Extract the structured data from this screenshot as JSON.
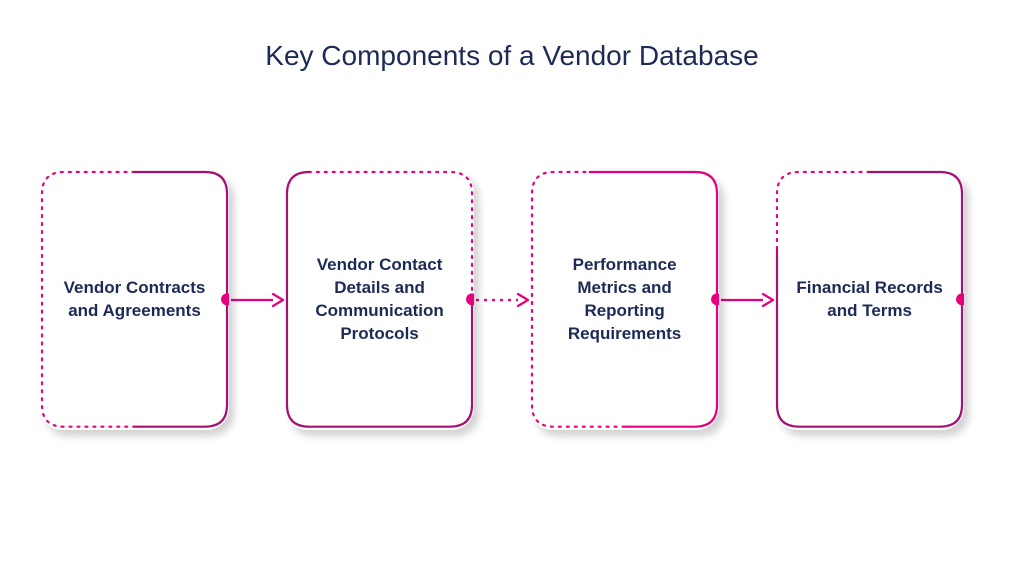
{
  "title": "Key Components of a Vendor Database",
  "colors": {
    "text": "#1c2a55",
    "magenta": "#e6007e",
    "magentaDark": "#a41173"
  },
  "cards": [
    {
      "label": "Vendor Contracts and Agreements"
    },
    {
      "label": "Vendor Contact Details and Communication Protocols"
    },
    {
      "label": "Performance Metrics and Reporting Requirements"
    },
    {
      "label": "Financial Records and Terms"
    }
  ]
}
